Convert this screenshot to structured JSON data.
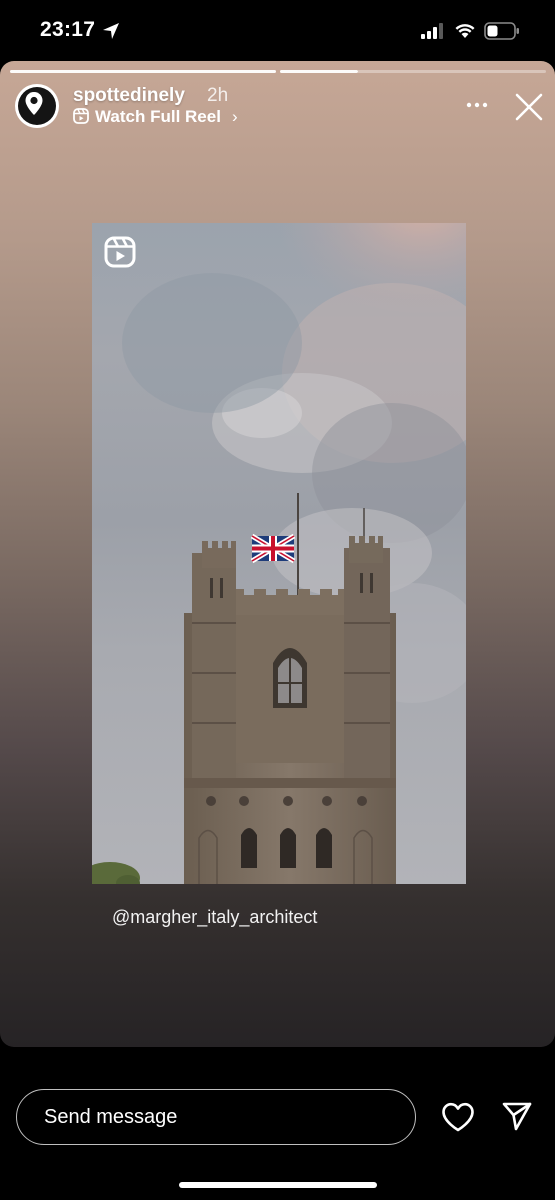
{
  "status_bar": {
    "time": "23:17",
    "icons": [
      "location-arrow-icon",
      "cellular-signal-icon",
      "wifi-icon",
      "battery-icon"
    ]
  },
  "story": {
    "progress_segments": [
      {
        "state": "viewed"
      },
      {
        "state": "current",
        "progress": 1.0
      },
      {
        "state": "upcoming"
      }
    ],
    "username": "spottedinely",
    "time_ago": "2h",
    "watch_full_reel": "Watch Full Reel",
    "watch_chevron": "›",
    "caption": "@margher_italy_architect"
  },
  "reel_preview": {
    "icon": "reels-icon"
  },
  "bottom_bar": {
    "message_placeholder": "Send message",
    "icons": [
      "heart-icon",
      "send-icon"
    ]
  },
  "colors": {
    "story_bg_top": "#c6a796",
    "story_bg_bottom": "#262325",
    "sky": "#9ba3ad",
    "tower": "#7e6f5e",
    "flag_blue": "#1e3c7a",
    "flag_red": "#c8102e"
  }
}
